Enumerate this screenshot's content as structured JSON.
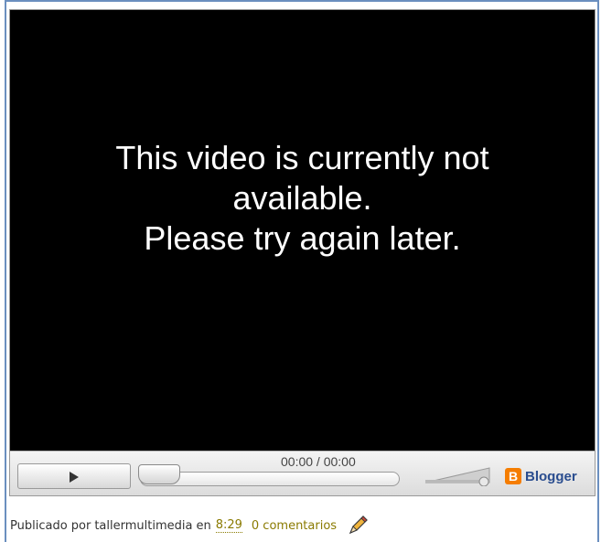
{
  "player": {
    "message_line1": "This video is currently not",
    "message_line2": "available.",
    "message_line3": "Please try again later.",
    "time_display": "00:00 / 00:00",
    "play_icon": "play-icon",
    "volume_icon": "volume-slider",
    "brand": {
      "logo_letter": "B",
      "label": "Blogger",
      "color": "#f57d00"
    }
  },
  "post_footer": {
    "published_by_label": "Publicado por",
    "author": "tallermultimedia",
    "in_label": "en",
    "time": "8:29",
    "comments": "0 comentarios",
    "edit_icon": "pencil-icon"
  }
}
